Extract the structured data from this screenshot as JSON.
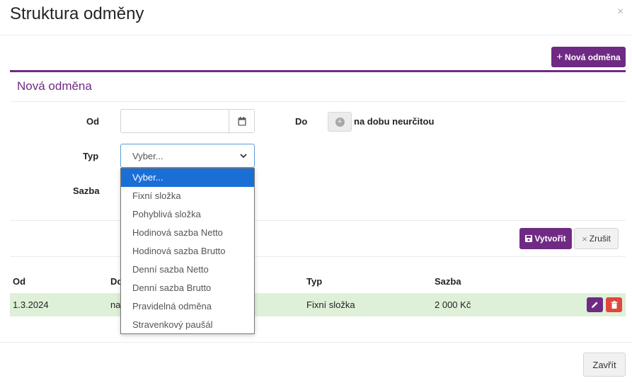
{
  "modal": {
    "title": "Struktura odměny",
    "close_glyph": "×"
  },
  "toolbar": {
    "new_reward_label": "Nová odměna",
    "new_reward_icon": "plus-icon"
  },
  "form": {
    "section_title": "Nová odměna",
    "from_label": "Od",
    "from_value": "",
    "to_label": "Do",
    "indefinite_label": "na dobu neurčitou",
    "type_label": "Typ",
    "type_selected": "Vyber...",
    "type_options": [
      "Vyber...",
      "Fixní složka",
      "Pohyblivá složka",
      "Hodinová sazba Netto",
      "Hodinová sazba Brutto",
      "Denní sazba Netto",
      "Denní sazba Brutto",
      "Pravidelná odměna",
      "Stravenkový paušál"
    ],
    "rate_label": "Sazba",
    "create_label": "Vytvořit",
    "cancel_label": "Zrušit"
  },
  "table": {
    "columns": [
      "Od",
      "Do",
      "Typ",
      "Sazba"
    ],
    "rows": [
      {
        "from": "1.3.2024",
        "to": "na",
        "type": "Fixní složka",
        "rate": "2 000 Kč"
      }
    ]
  },
  "footer": {
    "close_label": "Zavřít"
  },
  "colors": {
    "accent": "#6f2b83",
    "danger": "#e0483d",
    "success_row": "#dff0d8",
    "selected_option": "#1a6fd6"
  }
}
